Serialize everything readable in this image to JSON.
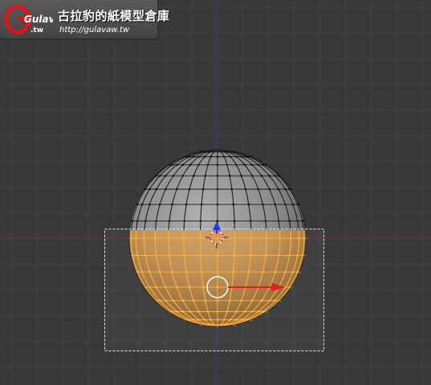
{
  "watermark": {
    "title": "古拉豹的紙模型倉庫",
    "url": "http://gulavaw.tw",
    "logo_text": "Gulav",
    "logo_sub": ".tw"
  },
  "colors": {
    "background": "#393939",
    "grid": "#464646",
    "x_axis": "#7a2a2a",
    "z_axis": "#3535a0",
    "mesh_unselected_fill": "#8a8a8a",
    "mesh_unselected_edge": "#1a1a1a",
    "mesh_selected_fill": "#c99a5a",
    "mesh_selected_edge": "#ffa838",
    "box_select": "#e6e6e6",
    "manipulator_x": "#e02020",
    "manipulator_z": "#2030ff",
    "cursor": "#d04040",
    "logo_red": "#d81818"
  },
  "icons": {
    "logo": "gulavaw-logo-icon",
    "cursor": "3d-cursor-icon",
    "manipulator": "transform-manipulator-icon",
    "pivot": "pivot-circle-icon"
  }
}
